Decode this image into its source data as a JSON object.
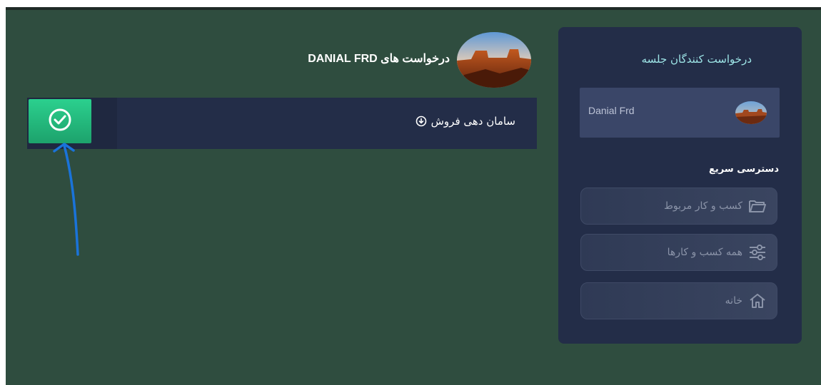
{
  "sidebar": {
    "title": "درخواست کنندگان جلسه",
    "attendee_name": "Danial Frd",
    "quick_access_title": "دسترسی سریع",
    "quick_links": [
      {
        "label": "کسب و کار مربوط",
        "icon": "folder-icon"
      },
      {
        "label": "همه کسب و کارها",
        "icon": "sliders-icon"
      },
      {
        "label": "خانه",
        "icon": "home-icon"
      }
    ]
  },
  "main": {
    "title": "درخواست های DANIAL FRD",
    "request_item": {
      "label": "سامان دهی فروش",
      "icon": "download-circle-icon",
      "action_icon": "check-circle-icon"
    }
  },
  "colors": {
    "background": "#2f4d3f",
    "panel": "#232d48",
    "accent_green": "#2bd08e",
    "annotation_arrow": "#1a73d9"
  }
}
